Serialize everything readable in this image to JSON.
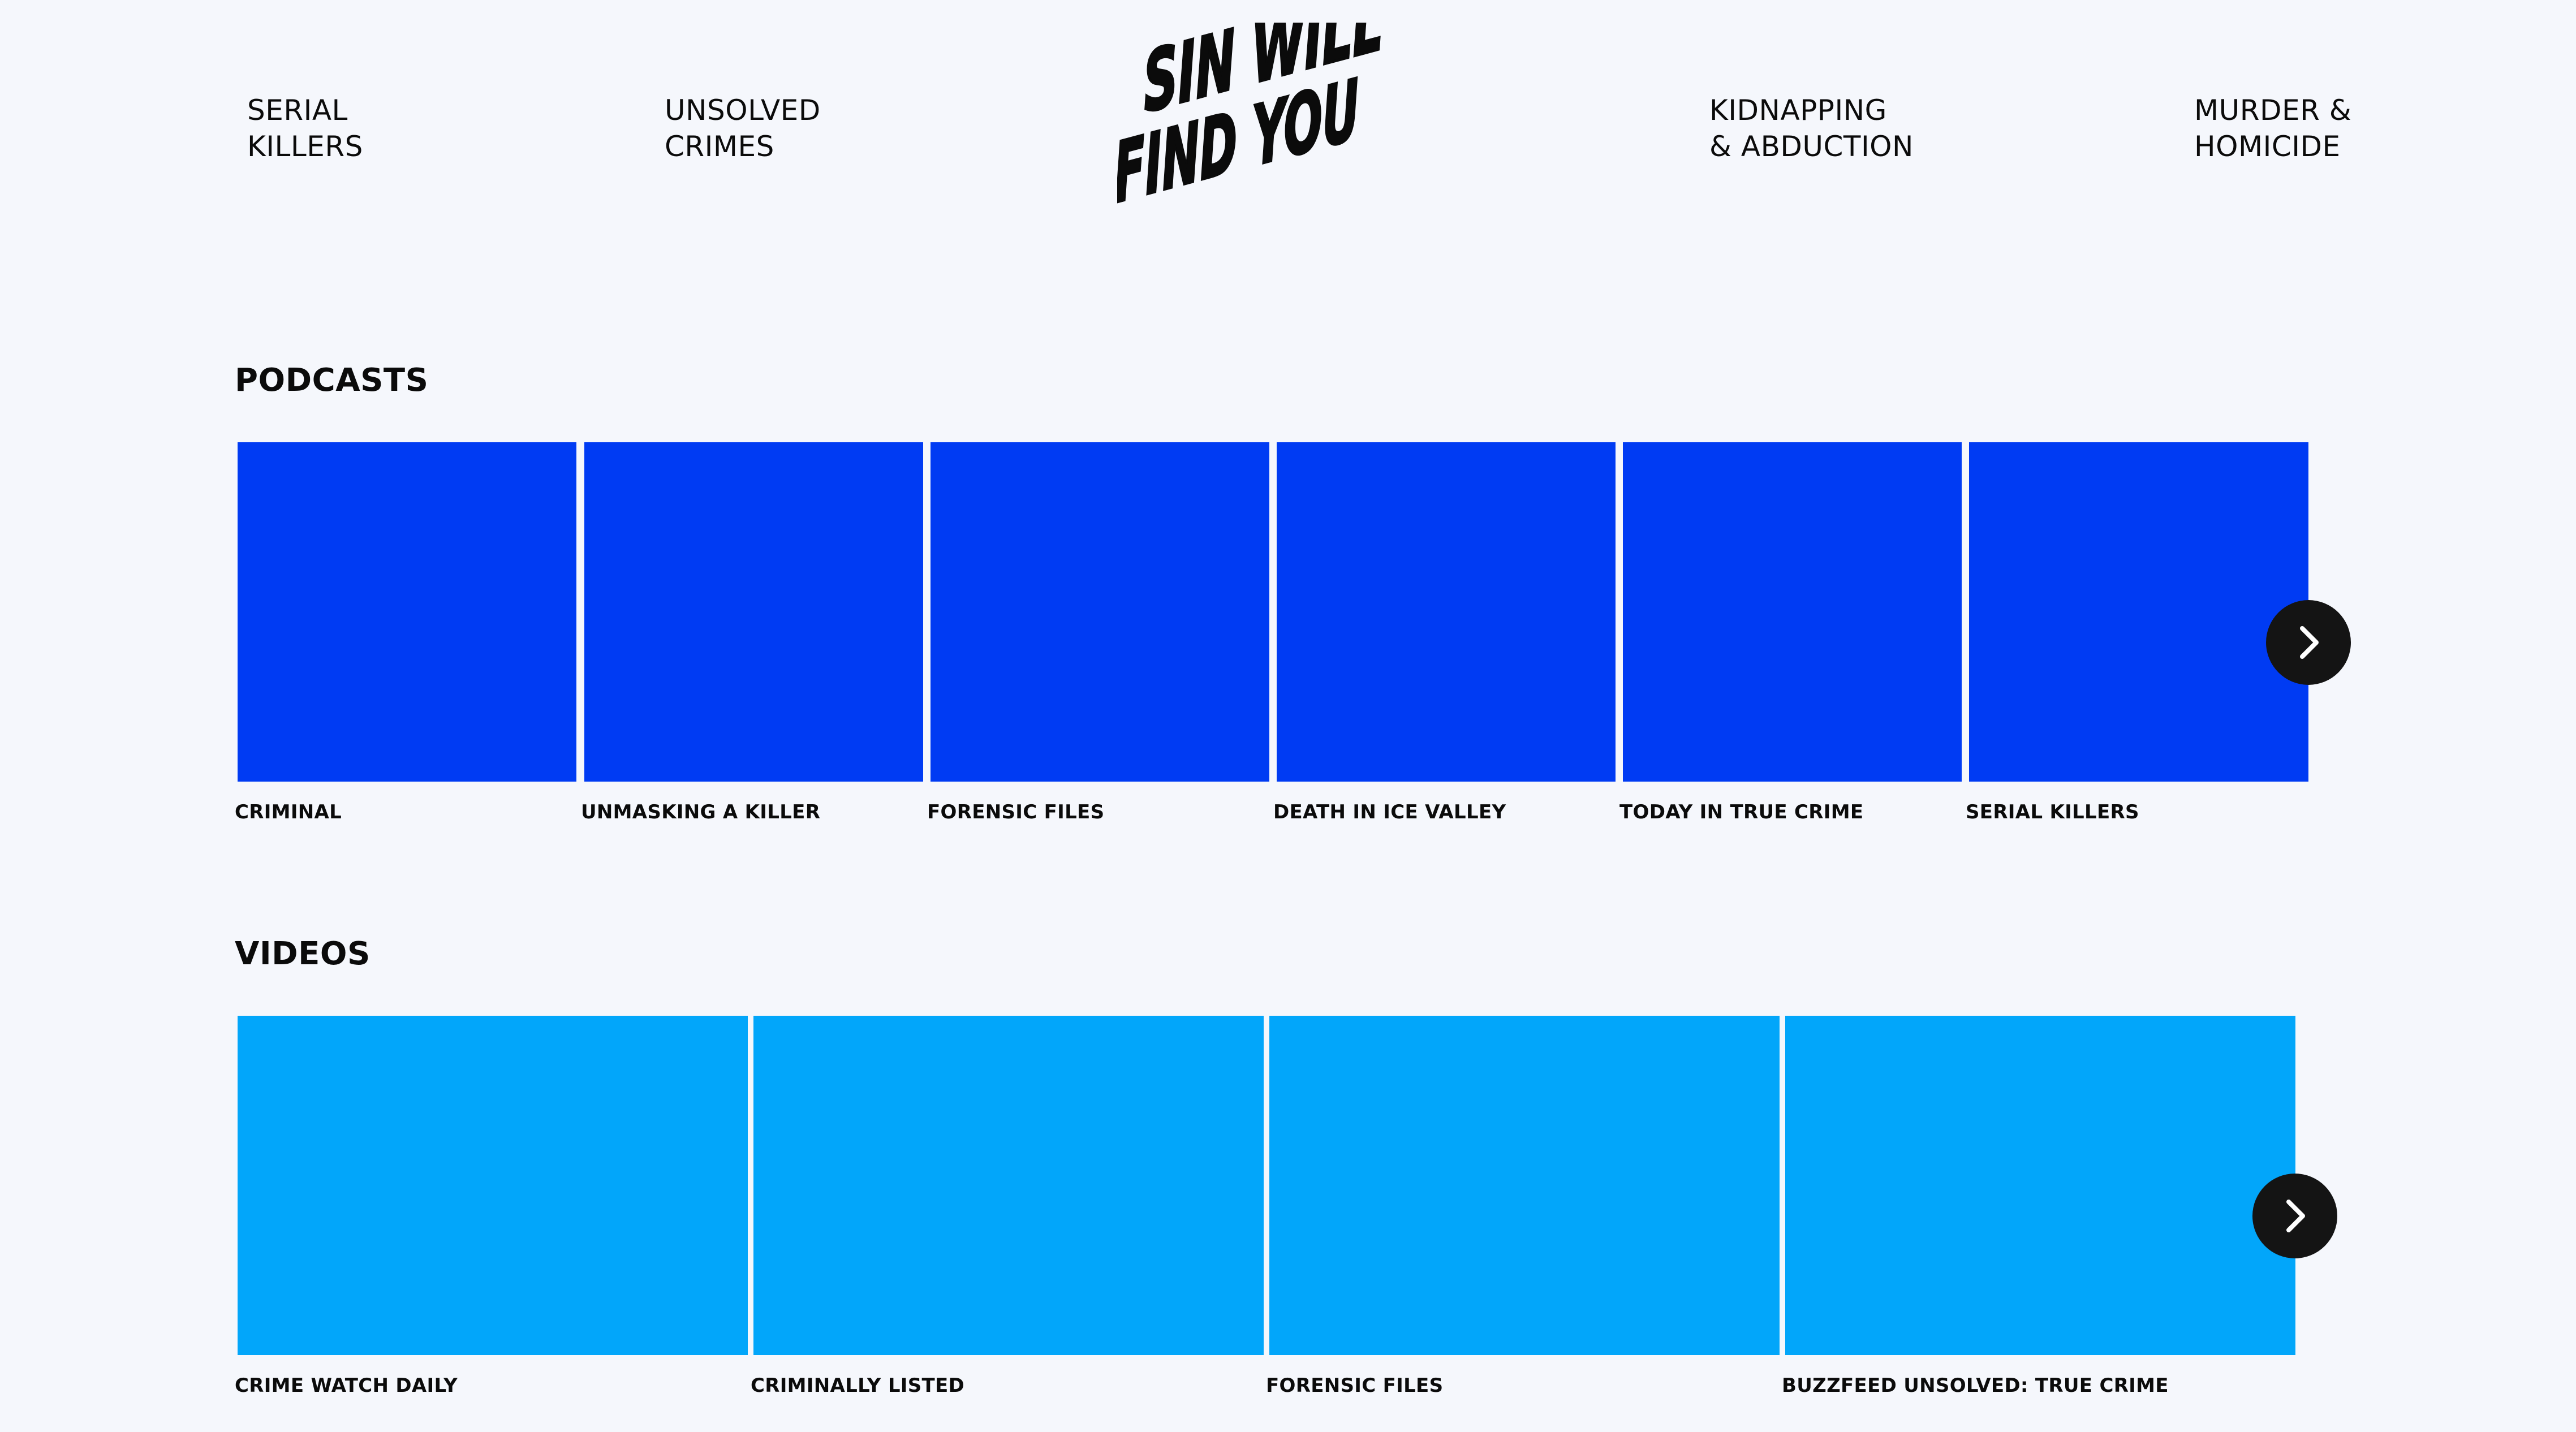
{
  "colors": {
    "background": "#f5f7fc",
    "podcast_tile": "#003bf3",
    "video_tile": "#02a6fa",
    "arrow_button": "#141414",
    "text": "#0b0b0b"
  },
  "nav": {
    "serial_killers": [
      "SERIAL",
      "KILLERS"
    ],
    "unsolved_crimes": [
      "UNSOLVED",
      "CRIMES"
    ],
    "kidnapping": [
      "KIDNAPPING",
      "& ABDUCTION"
    ],
    "murder": [
      "MURDER &",
      "HOMICIDE"
    ]
  },
  "logo": {
    "line1": "SIN WILL",
    "line2": "FIND YOU"
  },
  "podcasts": {
    "title": "PODCASTS",
    "items": [
      "CRIMINAL",
      "UNMASKING A KILLER",
      "FORENSIC FILES",
      "DEATH IN ICE VALLEY",
      "TODAY IN TRUE CRIME",
      "SERIAL KILLERS"
    ],
    "next_icon": "chevron-right-icon"
  },
  "videos": {
    "title": "VIDEOS",
    "items": [
      "CRIME WATCH DAILY",
      "CRIMINALLY LISTED",
      "FORENSIC FILES",
      "BUZZFEED UNSOLVED: TRUE CRIME"
    ],
    "next_icon": "chevron-right-icon"
  }
}
